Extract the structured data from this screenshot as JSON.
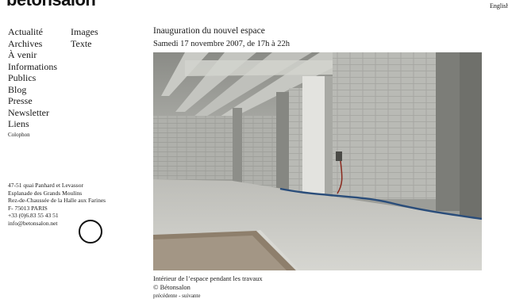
{
  "header": {
    "logo": "betonsalon",
    "language_link": "English"
  },
  "nav": {
    "main": [
      "Actualité",
      "Archives",
      "À venir",
      "Informations",
      "Publics",
      "Blog",
      "Presse",
      "Newsletter",
      "Liens",
      "Colophon"
    ],
    "secondary": [
      "Images",
      "Texte"
    ]
  },
  "address": {
    "lines": [
      "47-51 quai Panhard et Levassor",
      "Esplanade des Grands Moulins",
      "Rez-de-Chaussée de la Halle aux Farines",
      "F- 75013 PARIS",
      "+33 (0)6.83 55 43 51",
      "info@betonsalon.net"
    ]
  },
  "main": {
    "title": "Inauguration du nouvel espace",
    "date": "Samedi 17 novembre 2007, de 17h à 22h",
    "caption": {
      "line1": "Intérieur de l’espace pendant les travaux",
      "line2": "© Bétonsalon"
    },
    "pager": {
      "previous": "précédente",
      "separator": " - ",
      "next": "suivante"
    }
  }
}
